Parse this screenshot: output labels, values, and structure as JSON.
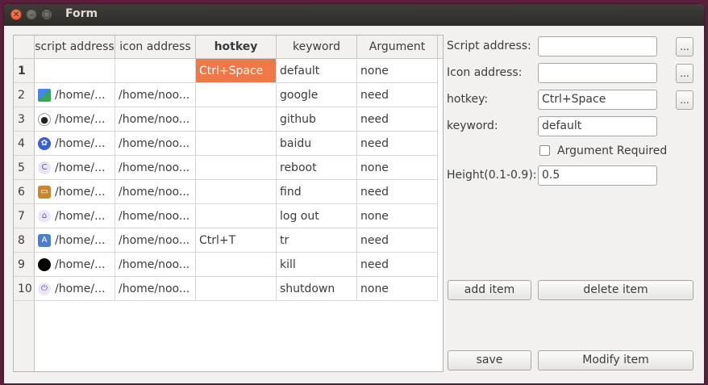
{
  "window": {
    "title": "Form"
  },
  "table": {
    "headers": [
      "script address",
      "icon address",
      "hotkey",
      "keyword",
      "Argument"
    ],
    "rows": [
      {
        "num": "1",
        "script": "",
        "icon": "",
        "hotkey": "Ctrl+Space",
        "keyword": "default",
        "argument": "none",
        "icon_name": ""
      },
      {
        "num": "2",
        "script": "/home/...",
        "icon": "/home/noo...",
        "hotkey": "",
        "keyword": "google",
        "argument": "need",
        "icon_name": "google-icon"
      },
      {
        "num": "3",
        "script": "/home/...",
        "icon": "/home/noo...",
        "hotkey": "",
        "keyword": "github",
        "argument": "need",
        "icon_name": "github-icon"
      },
      {
        "num": "4",
        "script": "/home/...",
        "icon": "/home/noo...",
        "hotkey": "",
        "keyword": "baidu",
        "argument": "need",
        "icon_name": "baidu-icon"
      },
      {
        "num": "5",
        "script": "/home/...",
        "icon": "/home/noo...",
        "hotkey": "",
        "keyword": "reboot",
        "argument": "none",
        "icon_name": "reboot-icon"
      },
      {
        "num": "6",
        "script": "/home/...",
        "icon": "/home/noo...",
        "hotkey": "",
        "keyword": "find",
        "argument": "need",
        "icon_name": "find-icon"
      },
      {
        "num": "7",
        "script": "/home/...",
        "icon": "/home/noo...",
        "hotkey": "",
        "keyword": "log out",
        "argument": "none",
        "icon_name": "logout-icon"
      },
      {
        "num": "8",
        "script": "/home/...",
        "icon": "/home/noo...",
        "hotkey": "Ctrl+T",
        "keyword": "tr",
        "argument": "need",
        "icon_name": "translate-icon"
      },
      {
        "num": "9",
        "script": "/home/...",
        "icon": "/home/noo...",
        "hotkey": "",
        "keyword": "kill",
        "argument": "need",
        "icon_name": "kill-icon"
      },
      {
        "num": "10",
        "script": "/home/...",
        "icon": "/home/noo...",
        "hotkey": "",
        "keyword": "shutdown",
        "argument": "none",
        "icon_name": "shutdown-icon"
      }
    ]
  },
  "form": {
    "script_label": "Script address:",
    "script_value": "",
    "icon_label": "Icon address:",
    "icon_value": "",
    "hotkey_label": "hotkey:",
    "hotkey_value": "Ctrl+Space",
    "keyword_label": "keyword:",
    "keyword_value": "default",
    "argument_label": "Argument Required",
    "height_label": "Height(0.1-0.9):",
    "height_value": "0.5",
    "browse_label": "..."
  },
  "buttons": {
    "add": "add item",
    "delete": "delete item",
    "save": "save",
    "modify": "Modify item"
  },
  "colors": {
    "selection": "#f07746",
    "titlebar": "#3e3d39",
    "desktop": "#5a1f3a"
  }
}
